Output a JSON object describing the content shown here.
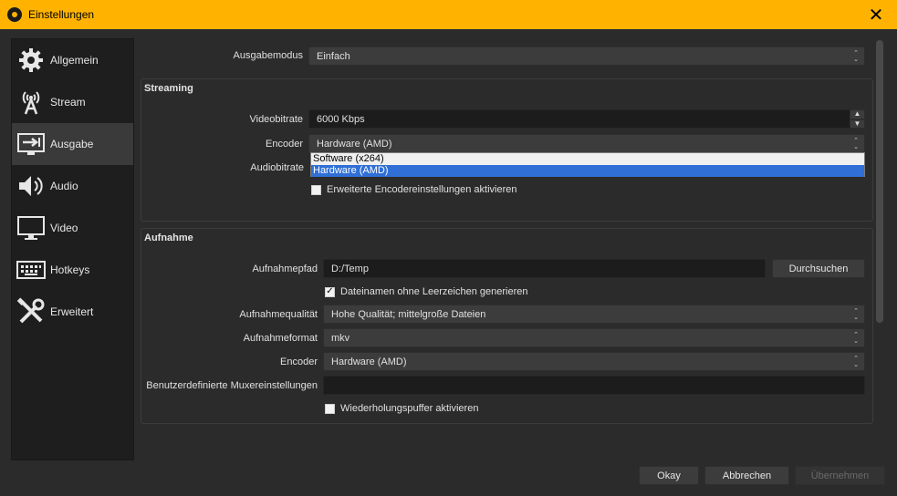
{
  "window": {
    "title": "Einstellungen",
    "close_glyph": "✕"
  },
  "sidebar": {
    "items": [
      {
        "label": "Allgemein",
        "icon": "gear-icon",
        "active": false
      },
      {
        "label": "Stream",
        "icon": "broadcast-icon",
        "active": false
      },
      {
        "label": "Ausgabe",
        "icon": "output-icon",
        "active": true
      },
      {
        "label": "Audio",
        "icon": "speaker-icon",
        "active": false
      },
      {
        "label": "Video",
        "icon": "monitor-icon",
        "active": false
      },
      {
        "label": "Hotkeys",
        "icon": "keyboard-icon",
        "active": false
      },
      {
        "label": "Erweitert",
        "icon": "tools-icon",
        "active": false
      }
    ]
  },
  "output_mode": {
    "label": "Ausgabemodus",
    "value": "Einfach"
  },
  "streaming": {
    "title": "Streaming",
    "video_bitrate": {
      "label": "Videobitrate",
      "value": "6000 Kbps"
    },
    "encoder": {
      "label": "Encoder",
      "value": "Hardware (AMD)"
    },
    "audio_bitrate": {
      "label": "Audiobitrate"
    },
    "advanced_checkbox": {
      "label": "Erweiterte Encodereinstellungen aktivieren",
      "checked": false
    },
    "encoder_options": [
      "Software (x264)",
      "Hardware (AMD)"
    ],
    "encoder_selected_index": 1
  },
  "recording": {
    "title": "Aufnahme",
    "path": {
      "label": "Aufnahmepfad",
      "value": "D:/Temp",
      "browse_label": "Durchsuchen"
    },
    "no_spaces_checkbox": {
      "label": "Dateinamen ohne Leerzeichen generieren",
      "checked": true
    },
    "quality": {
      "label": "Aufnahmequalität",
      "value": "Hohe Qualität; mittelgroße Dateien"
    },
    "format": {
      "label": "Aufnahmeformat",
      "value": "mkv"
    },
    "encoder": {
      "label": "Encoder",
      "value": "Hardware (AMD)"
    },
    "muxer": {
      "label": "Benutzerdefinierte Muxereinstellungen",
      "value": ""
    },
    "replay_buffer_checkbox": {
      "label": "Wiederholungspuffer aktivieren",
      "checked": false
    }
  },
  "footer": {
    "ok_label": "Okay",
    "cancel_label": "Abbrechen",
    "apply_label": "Übernehmen"
  },
  "colors": {
    "titlebar": "#ffb300",
    "selection": "#2f6fd6",
    "background": "#2b2b2b"
  }
}
